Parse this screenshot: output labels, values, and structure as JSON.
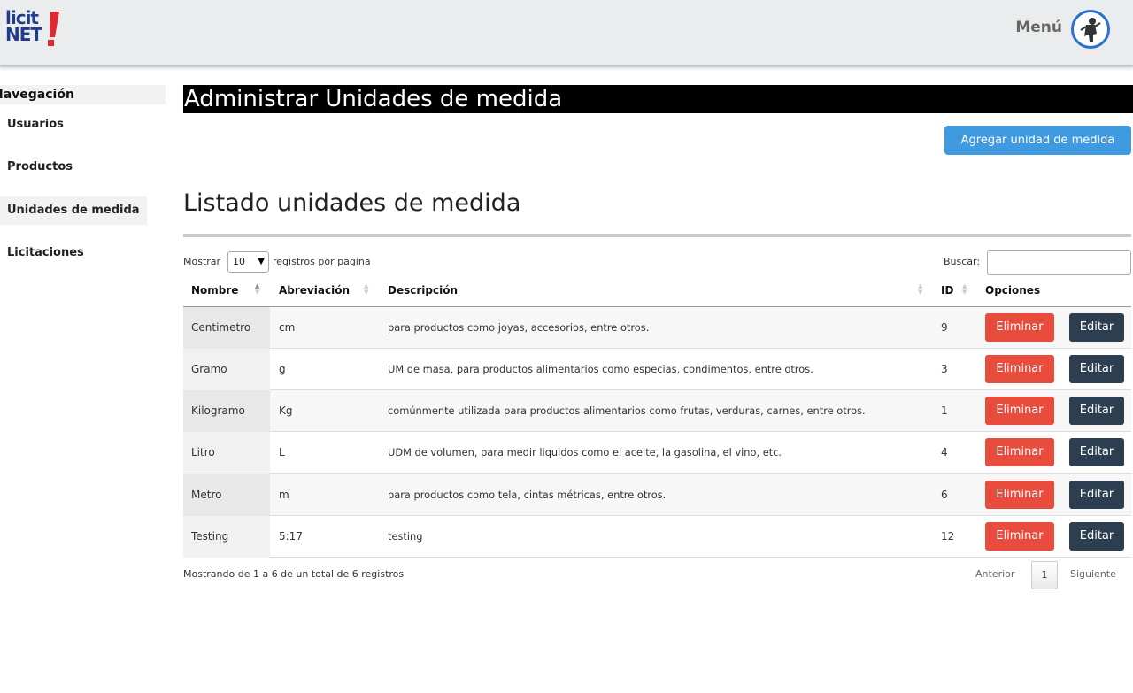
{
  "header": {
    "logo_top": "licit",
    "logo_bottom": "NET",
    "menu_label": "Menú",
    "brand_colors": {
      "logo_blue": "#1f3c8f",
      "logo_red": "#e0282e"
    }
  },
  "sidebar": {
    "title": "Navegación",
    "items": [
      {
        "label": "Usuarios",
        "active": false
      },
      {
        "label": "Productos",
        "active": false
      },
      {
        "label": "Unidades de medida",
        "active": true
      },
      {
        "label": "Licitaciones",
        "active": false
      }
    ]
  },
  "main": {
    "page_title": "Administrar Unidades de medida",
    "add_button": "Agregar unidad de medida",
    "list_title": "Listado unidades de medida",
    "length": {
      "prefix": "Mostrar",
      "value": "10",
      "suffix": "registros por pagina"
    },
    "search_label": "Buscar:",
    "search_value": "",
    "columns": [
      "Nombre",
      "Abreviación",
      "Descripción",
      "ID",
      "Opciones"
    ],
    "rows": [
      {
        "nombre": "Centimetro",
        "abreviacion": "cm",
        "descripcion": "para productos como joyas, accesorios, entre otros.",
        "id": "9"
      },
      {
        "nombre": "Gramo",
        "abreviacion": "g",
        "descripcion": "UM de masa, para productos alimentarios como especias, condimentos, entre otros.",
        "id": "3"
      },
      {
        "nombre": "Kilogramo",
        "abreviacion": "Kg",
        "descripcion": "comúnmente utilizada para productos alimentarios como frutas, verduras, carnes, entre otros.",
        "id": "1"
      },
      {
        "nombre": "Litro",
        "abreviacion": "L",
        "descripcion": "UDM de volumen, para medir liquidos como el aceite, la gasolina, el vino, etc.",
        "id": "4"
      },
      {
        "nombre": "Metro",
        "abreviacion": "m",
        "descripcion": "para productos como tela, cintas métricas, entre otros.",
        "id": "6"
      },
      {
        "nombre": "Testing",
        "abreviacion": "5:17",
        "descripcion": "testing",
        "id": "12"
      }
    ],
    "delete_label": "Eliminar",
    "edit_label": "Editar",
    "info": "Mostrando de 1 a 6 de un total de 6 registros",
    "pagination": {
      "prev": "Anterior",
      "current": "1",
      "next": "Siguiente"
    },
    "colors": {
      "add_button": "#3f9ae0",
      "delete_button": "#e74c3c",
      "edit_button": "#2c3e50",
      "title_bar": "#000000"
    }
  }
}
